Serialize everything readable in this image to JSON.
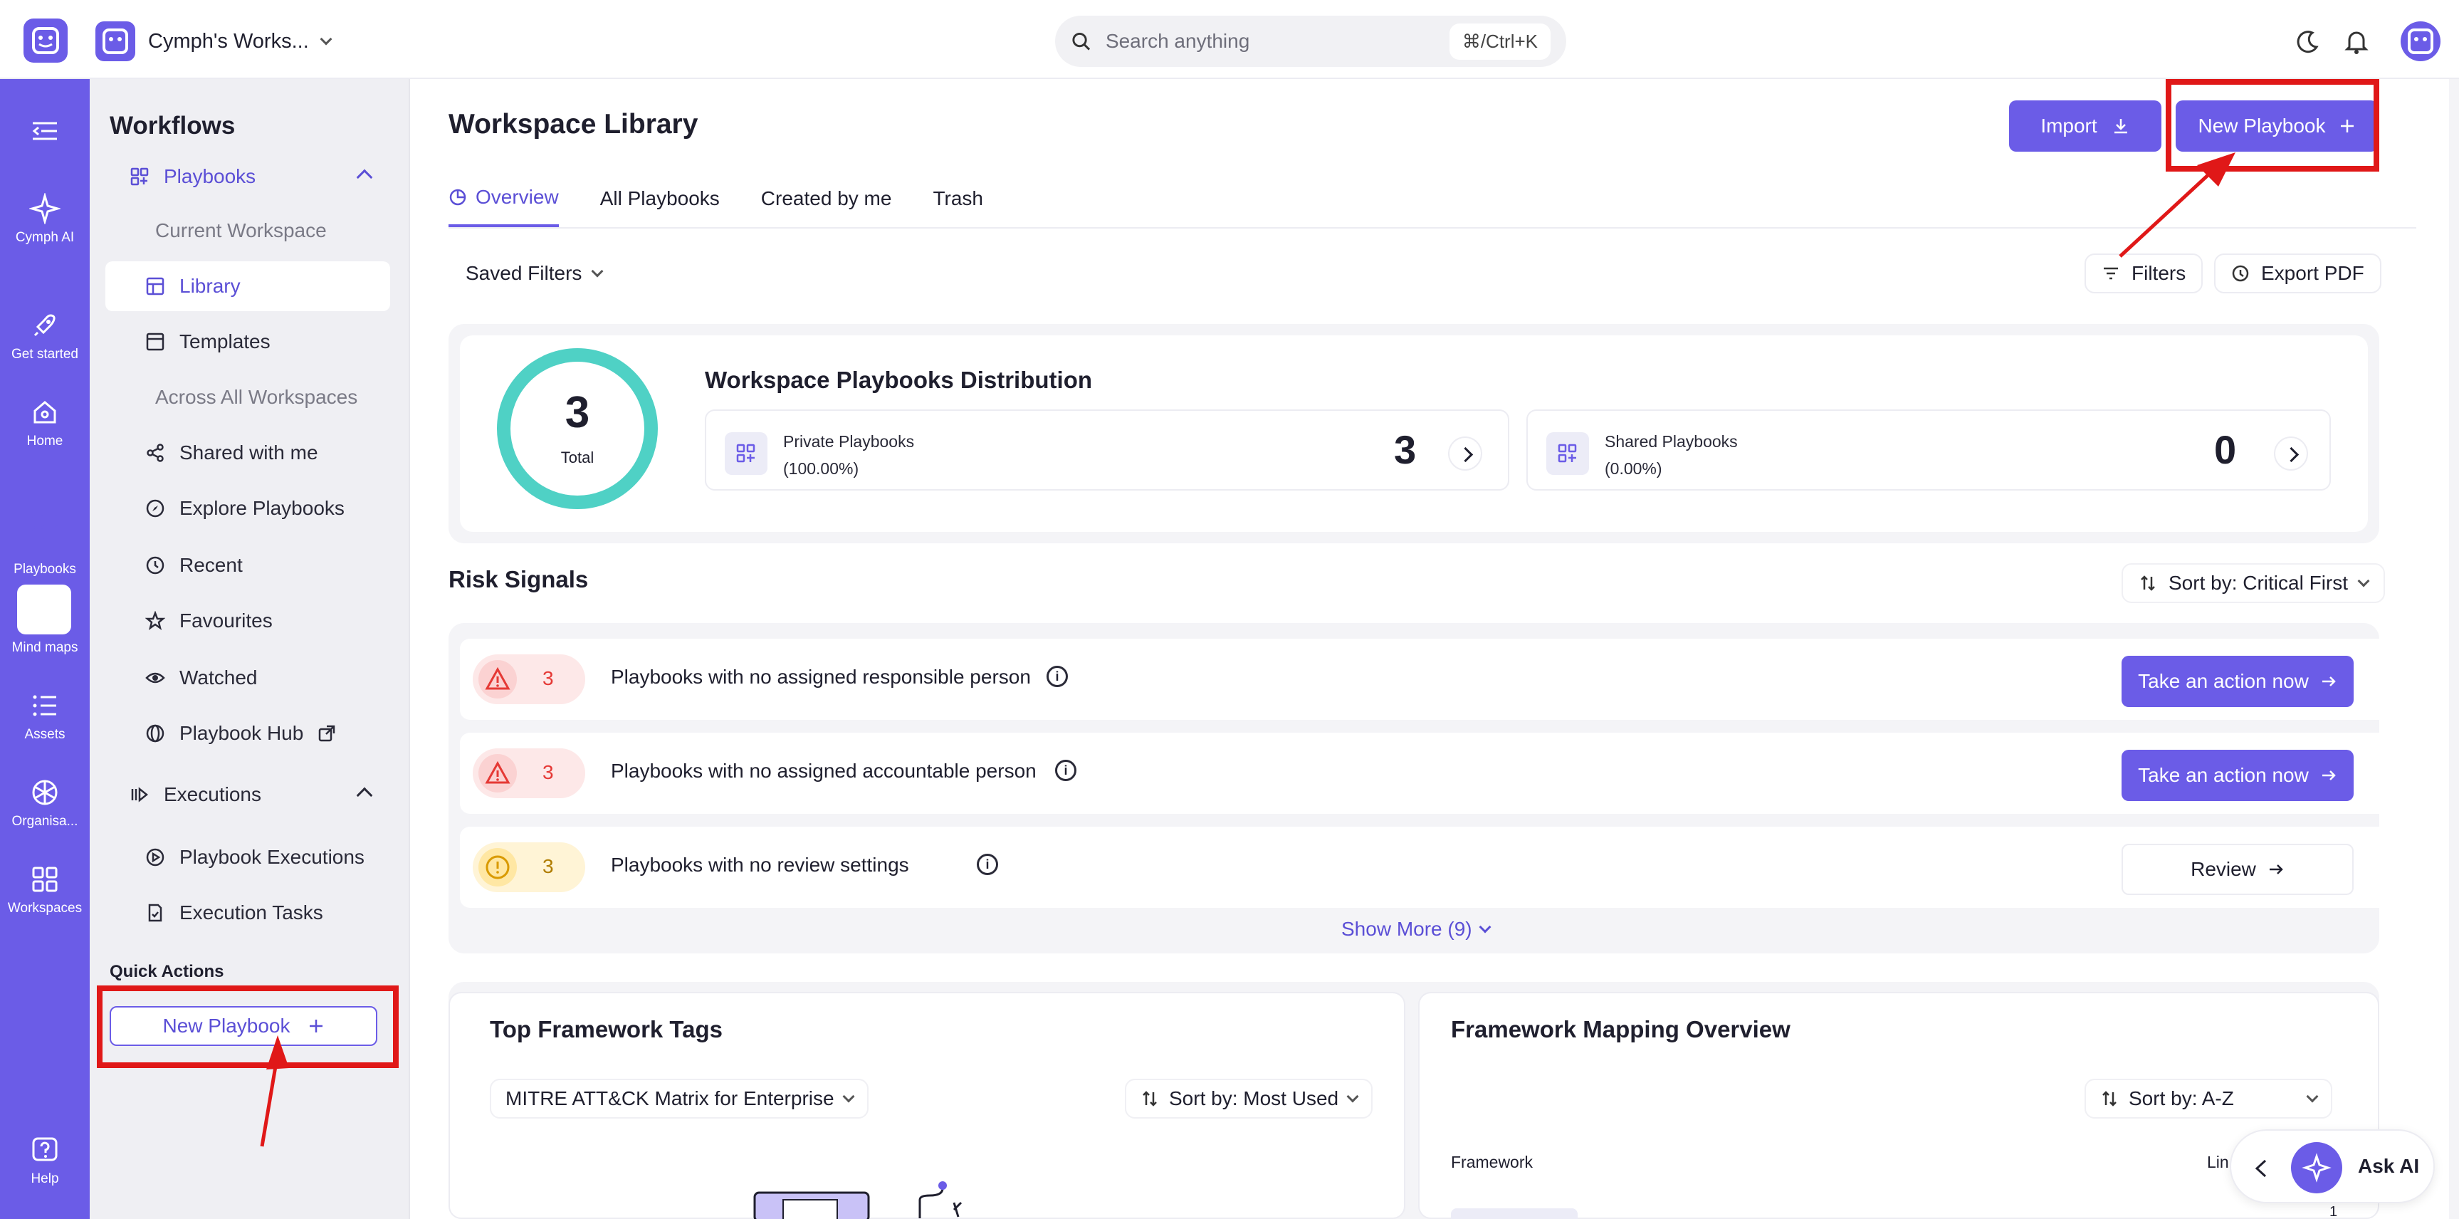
{
  "app": {
    "workspace_name": "Cymph's Works...",
    "search_placeholder": "Search anything",
    "search_shortcut": "⌘/Ctrl+K"
  },
  "rail": {
    "items": [
      {
        "label": "Cymph AI",
        "icon": "sparkle-icon"
      },
      {
        "label": "Get started",
        "icon": "rocket-icon"
      },
      {
        "label": "Home",
        "icon": "home-icon"
      },
      {
        "label": "Playbooks",
        "icon": "playbooks-icon"
      },
      {
        "label": "Mind maps",
        "icon": "mindmap-icon"
      },
      {
        "label": "Assets",
        "icon": "list-icon"
      },
      {
        "label": "Organisa...",
        "icon": "organisation-icon"
      },
      {
        "label": "Workspaces",
        "icon": "workspaces-icon"
      },
      {
        "label": "Help",
        "icon": "help-icon"
      }
    ]
  },
  "sidebar": {
    "title": "Workflows",
    "playbooks_label": "Playbooks",
    "current_workspace_label": "Current Workspace",
    "library_label": "Library",
    "templates_label": "Templates",
    "across_label": "Across All Workspaces",
    "shared_label": "Shared with me",
    "explore_label": "Explore Playbooks",
    "recent_label": "Recent",
    "favourites_label": "Favourites",
    "watched_label": "Watched",
    "hub_label": "Playbook Hub",
    "executions_label": "Executions",
    "playbook_executions_label": "Playbook Executions",
    "execution_tasks_label": "Execution Tasks",
    "quick_actions_label": "Quick Actions",
    "new_playbook_label": "New Playbook"
  },
  "main": {
    "title": "Workspace Library",
    "import_label": "Import",
    "new_playbook_label": "New Playbook",
    "tabs": [
      {
        "label": "Overview"
      },
      {
        "label": "All Playbooks"
      },
      {
        "label": "Created by me"
      },
      {
        "label": "Trash"
      }
    ],
    "saved_filters_label": "Saved Filters",
    "filters_label": "Filters",
    "export_pdf_label": "Export PDF",
    "distribution": {
      "title": "Workspace Playbooks Distribution",
      "total_value": "3",
      "total_label": "Total",
      "private_label": "Private Playbooks",
      "private_pct": "(100.00%)",
      "private_count": "3",
      "shared_label": "Shared Playbooks",
      "shared_pct": "(0.00%)",
      "shared_count": "0"
    },
    "risk": {
      "title": "Risk Signals",
      "sort_label": "Sort by: Critical First",
      "rows": [
        {
          "count": "3",
          "text": "Playbooks with no assigned responsible person",
          "action": "Take an action now"
        },
        {
          "count": "3",
          "text": "Playbooks with no assigned accountable person",
          "action": "Take an action now"
        },
        {
          "count": "3",
          "text": "Playbooks with no review settings",
          "action": "Review"
        }
      ],
      "show_more_label": "Show More (9)"
    },
    "framework_tags": {
      "title": "Top Framework Tags",
      "selected": "MITRE ATT&CK Matrix for Enterprise",
      "sort_label": "Sort by: Most Used"
    },
    "mapping": {
      "title": "Framework Mapping Overview",
      "sort_label": "Sort by: A-Z",
      "column_framework": "Framework",
      "column_lin": "Lin",
      "cell_1": "1"
    },
    "ask_ai_label": "Ask AI"
  },
  "colors": {
    "brand": "#6b5ce7",
    "ring": "#4fd1c5",
    "danger": "#e53935",
    "warning": "#f5b400",
    "annotation": "#e01818"
  }
}
